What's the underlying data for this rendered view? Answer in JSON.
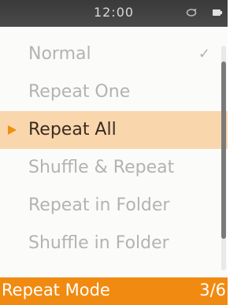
{
  "status_bar": {
    "time": "12:00",
    "icons": [
      "repeat-icon",
      "battery-icon"
    ]
  },
  "menu": {
    "items": [
      {
        "label": "Normal",
        "checked": true
      },
      {
        "label": "Repeat One",
        "checked": false
      },
      {
        "label": "Repeat All",
        "checked": false,
        "selected": true
      },
      {
        "label": "Shuffle & Repeat",
        "checked": false
      },
      {
        "label": "Repeat in Folder",
        "checked": false
      },
      {
        "label": "Shuffle in Folder",
        "checked": false
      }
    ],
    "check_glyph": "✓",
    "selected_index": 2
  },
  "scroll": {
    "position_fraction": 0.33,
    "visible_fraction": 0.79
  },
  "footer": {
    "title": "Repeat Mode",
    "count": "3/6"
  },
  "colors": {
    "status_bar": "#3f3f3f",
    "selected_bg": "#fad6ad",
    "accent": "#f18a10",
    "text_dim": "#b3b3b3"
  }
}
